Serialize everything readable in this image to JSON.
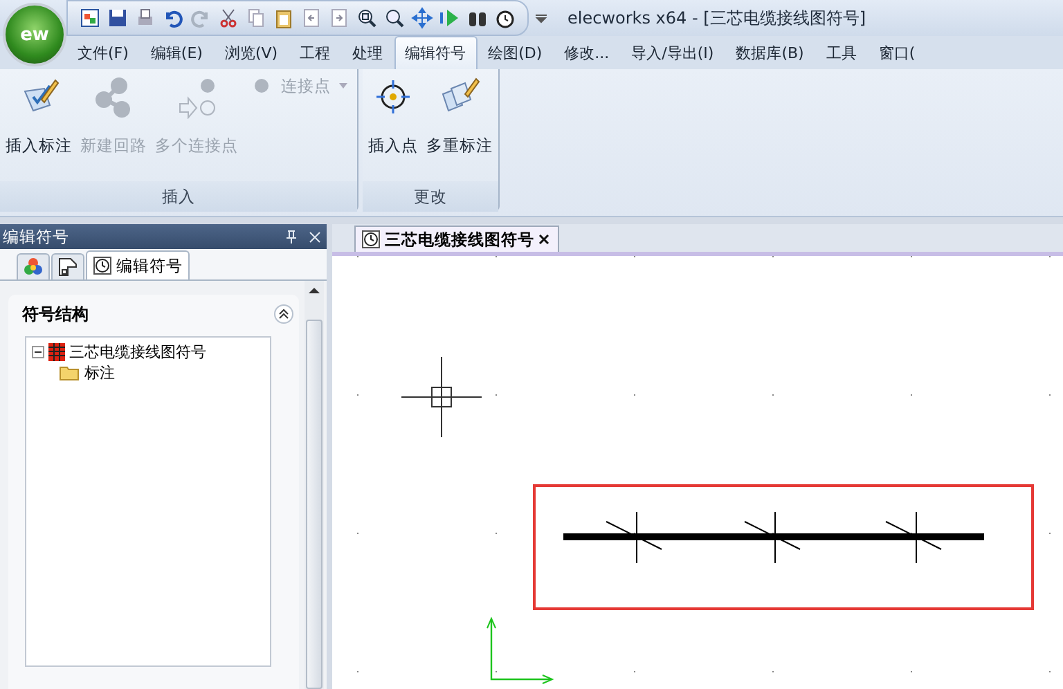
{
  "app": {
    "logo": "ew",
    "title": "elecworks x64 - [三芯电缆接线图符号]"
  },
  "menu_tabs": [
    {
      "label": "文件(F)",
      "selected": false
    },
    {
      "label": "编辑(E)",
      "selected": false
    },
    {
      "label": "浏览(V)",
      "selected": false
    },
    {
      "label": "工程",
      "selected": false
    },
    {
      "label": "处理",
      "selected": false
    },
    {
      "label": "编辑符号",
      "selected": true
    },
    {
      "label": "绘图(D)",
      "selected": false
    },
    {
      "label": "修改...",
      "selected": false
    },
    {
      "label": "导入/导出(I)",
      "selected": false
    },
    {
      "label": "数据库(B)",
      "selected": false
    },
    {
      "label": "工具",
      "selected": false
    },
    {
      "label": "窗口(",
      "selected": false
    }
  ],
  "ribbon": {
    "groups": [
      {
        "label": "插入",
        "buttons": [
          {
            "kind": "large",
            "label": "插入标注",
            "disabled": false
          },
          {
            "kind": "large",
            "label": "新建回路",
            "disabled": true
          },
          {
            "kind": "large",
            "label": "多个连接点",
            "disabled": true
          },
          {
            "kind": "small",
            "label": "连接点",
            "disabled": true
          }
        ]
      },
      {
        "label": "更改",
        "buttons": [
          {
            "kind": "large",
            "label": "插入点",
            "disabled": false
          },
          {
            "kind": "large",
            "label": "多重标注",
            "disabled": false
          }
        ]
      }
    ]
  },
  "panel": {
    "title": "编辑符号",
    "tabs": [
      {
        "kind": "palette",
        "selected": false
      },
      {
        "kind": "page",
        "selected": false
      },
      {
        "kind": "symbol",
        "label": "编辑符号",
        "selected": true
      }
    ],
    "section": {
      "title": "符号结构",
      "expanded": true
    },
    "tree": [
      {
        "label": "三芯电缆接线图符号",
        "expanded": true,
        "children": [
          {
            "label": "标注"
          }
        ]
      }
    ]
  },
  "document_tabs": [
    {
      "label": "三芯电缆接线图符号",
      "selected": true
    }
  ]
}
